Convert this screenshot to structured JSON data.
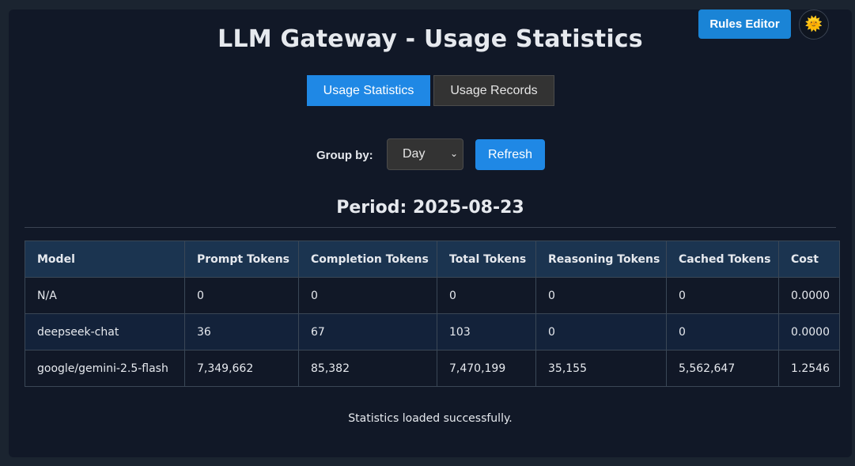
{
  "header": {
    "title": "LLM Gateway - Usage Statistics",
    "rules_editor_label": "Rules Editor",
    "theme_icon": "🌞"
  },
  "tabs": [
    {
      "label": "Usage Statistics",
      "active": true
    },
    {
      "label": "Usage Records",
      "active": false
    }
  ],
  "controls": {
    "group_by_label": "Group by:",
    "group_by_value": "Day",
    "refresh_label": "Refresh"
  },
  "period": "Period: 2025-08-23",
  "table": {
    "columns": [
      "Model",
      "Prompt Tokens",
      "Completion Tokens",
      "Total Tokens",
      "Reasoning Tokens",
      "Cached Tokens",
      "Cost"
    ],
    "rows": [
      [
        "N/A",
        "0",
        "0",
        "0",
        "0",
        "0",
        "0.0000"
      ],
      [
        "deepseek-chat",
        "36",
        "67",
        "103",
        "0",
        "0",
        "0.0000"
      ],
      [
        "google/gemini-2.5-flash",
        "7,349,662",
        "85,382",
        "7,470,199",
        "35,155",
        "5,562,647",
        "1.2546"
      ]
    ]
  },
  "status_message": "Statistics loaded successfully.",
  "colors": {
    "accent": "#1f88e5",
    "page_bg": "#1b2430",
    "card_bg": "#111827",
    "table_header_bg": "#1b3450"
  }
}
